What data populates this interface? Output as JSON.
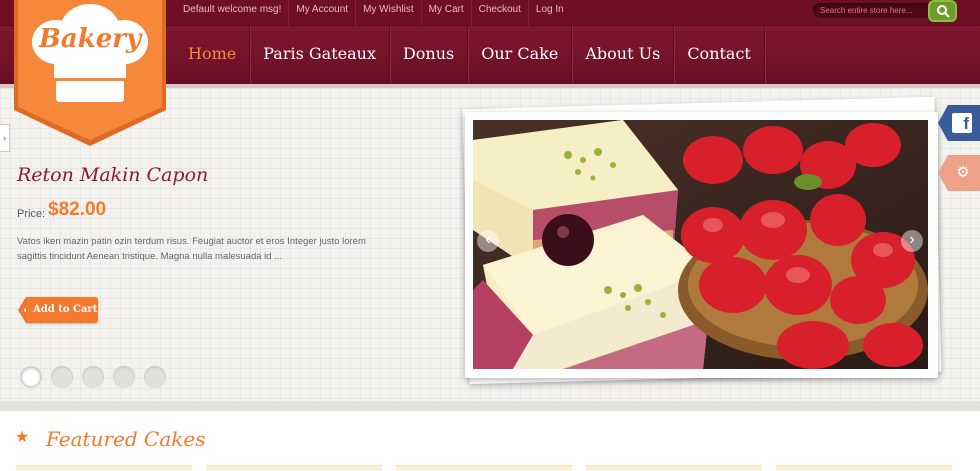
{
  "topbar": {
    "links": [
      "Default welcome msg!",
      "My Account",
      "My Wishlist",
      "My Cart",
      "Checkout",
      "Log In"
    ],
    "search_placeholder": "Search entire store here..."
  },
  "logo": {
    "text": "Bakery"
  },
  "nav": {
    "items": [
      "Home",
      "Paris Gateaux",
      "Donus",
      "Our Cake",
      "About Us",
      "Contact"
    ],
    "active": "Home"
  },
  "hero": {
    "product_title": "Reton Makin Capon",
    "price_label": "Price:",
    "price_value": "$82.00",
    "description": "Vatos iken mazin patin ozin terdum risus. Feugiat auctor et eros Integer justo lorem sagittis tincidunt Aenean tristique. Magna nulla malesuada id ...",
    "add_to_cart": "Add to Cart",
    "slide_count": 5,
    "active_slide": 1
  },
  "featured": {
    "title": "Featured Cakes",
    "card_count": 5
  },
  "colors": {
    "maroon": "#6e0f24",
    "accent_orange": "#f37a2d",
    "facebook_blue": "#3a5b9a",
    "search_green": "#6e9a2e"
  },
  "icons": [
    "chef-hat-icon",
    "search-icon",
    "facebook-icon",
    "gear-icon",
    "arrow-left-icon",
    "arrow-right-icon",
    "star-icon"
  ]
}
